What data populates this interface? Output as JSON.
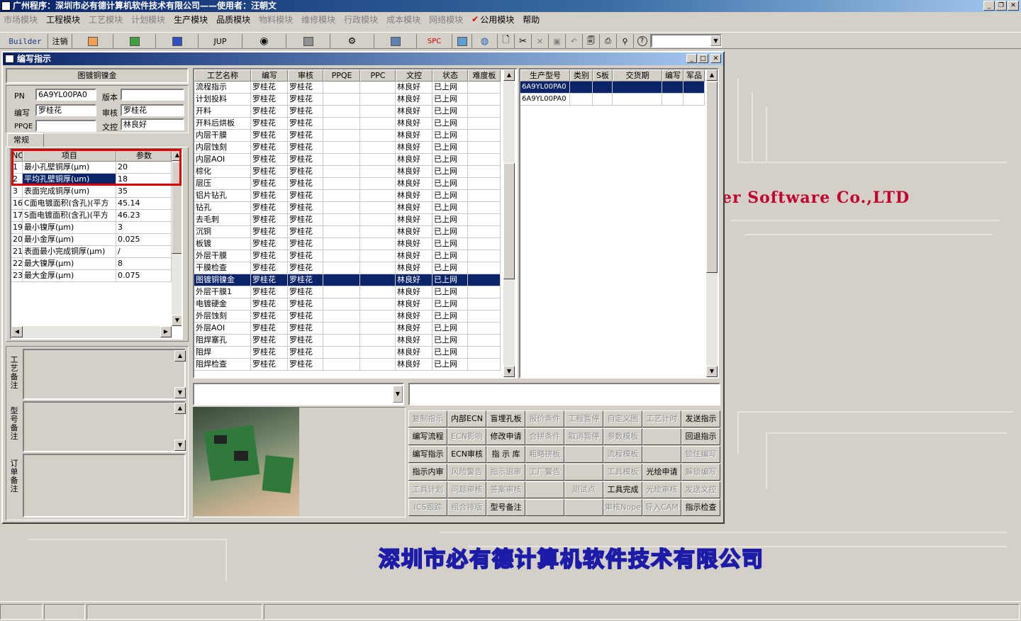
{
  "app": {
    "title": "广州程序：深圳市必有德计算机软件技术有限公司——使用者：汪朝文"
  },
  "menu": [
    "市场模块",
    "工程模块",
    "工艺模块",
    "计划模块",
    "生产模块",
    "品质模块",
    "物料模块",
    "维修模块",
    "行政模块",
    "成本模块",
    "网络模块",
    "公用模块",
    "帮助"
  ],
  "toolbar": {
    "builder": "Builder",
    "logout": "注销",
    "jup": "JUP",
    "spc": "SPC",
    "combo": ""
  },
  "window": {
    "title": "编写指示"
  },
  "info": {
    "product": "图镀铜镍金",
    "pn_label": "PN",
    "pn": "6A9YL00PA0",
    "version_label": "版本",
    "version": "",
    "editor_label": "编写",
    "editor": "罗桂花",
    "reviewer_label": "审核",
    "reviewer": "罗桂花",
    "ppqe_label": "PPQE",
    "ppqe": "",
    "doc_label": "文控",
    "doc": "林良好",
    "tab": "常规"
  },
  "params": {
    "headers": [
      "NO",
      "项目",
      "参数"
    ],
    "rows": [
      {
        "no": "1",
        "item": "最小孔壁铜厚(μm)",
        "value": "20"
      },
      {
        "no": "2",
        "item": "平均孔壁铜厚(um)",
        "value": "18"
      },
      {
        "no": "3",
        "item": "表面完成铜厚(um)",
        "value": "35"
      },
      {
        "no": "16",
        "item": "C面电镀面积(含孔)(平方",
        "value": "45.14"
      },
      {
        "no": "17",
        "item": "S面电镀面积(含孔)(平方",
        "value": "46.23"
      },
      {
        "no": "19",
        "item": "最小镍厚(μm)",
        "value": "3"
      },
      {
        "no": "20",
        "item": "最小金厚(μm)",
        "value": "0.025"
      },
      {
        "no": "21",
        "item": "表面最小完成铜厚(μm)",
        "value": "/"
      },
      {
        "no": "22",
        "item": "最大镍厚(μm)",
        "value": "8"
      },
      {
        "no": "23",
        "item": "最大金厚(μm)",
        "value": "0.075"
      }
    ]
  },
  "remarks": {
    "process": "工艺备注",
    "model": "型号备注",
    "order": "订单备注"
  },
  "process": {
    "headers": [
      "工艺名称",
      "编写",
      "审核",
      "PPQE",
      "PPC",
      "文控",
      "状态",
      "难度板"
    ],
    "rows": [
      [
        "流程指示",
        "罗桂花",
        "罗桂花",
        "",
        "",
        "林良好",
        "已上网",
        ""
      ],
      [
        "计划投料",
        "罗桂花",
        "罗桂花",
        "",
        "",
        "林良好",
        "已上网",
        ""
      ],
      [
        "开料",
        "罗桂花",
        "罗桂花",
        "",
        "",
        "林良好",
        "已上网",
        ""
      ],
      [
        "开料后烘板",
        "罗桂花",
        "罗桂花",
        "",
        "",
        "林良好",
        "已上网",
        ""
      ],
      [
        "内层干膜",
        "罗桂花",
        "罗桂花",
        "",
        "",
        "林良好",
        "已上网",
        ""
      ],
      [
        "内层蚀刻",
        "罗桂花",
        "罗桂花",
        "",
        "",
        "林良好",
        "已上网",
        ""
      ],
      [
        "内层AOI",
        "罗桂花",
        "罗桂花",
        "",
        "",
        "林良好",
        "已上网",
        ""
      ],
      [
        "棕化",
        "罗桂花",
        "罗桂花",
        "",
        "",
        "林良好",
        "已上网",
        ""
      ],
      [
        "层压",
        "罗桂花",
        "罗桂花",
        "",
        "",
        "林良好",
        "已上网",
        ""
      ],
      [
        "铝片钻孔",
        "罗桂花",
        "罗桂花",
        "",
        "",
        "林良好",
        "已上网",
        ""
      ],
      [
        "钻孔",
        "罗桂花",
        "罗桂花",
        "",
        "",
        "林良好",
        "已上网",
        ""
      ],
      [
        "去毛刺",
        "罗桂花",
        "罗桂花",
        "",
        "",
        "林良好",
        "已上网",
        ""
      ],
      [
        "沉铜",
        "罗桂花",
        "罗桂花",
        "",
        "",
        "林良好",
        "已上网",
        ""
      ],
      [
        "板镀",
        "罗桂花",
        "罗桂花",
        "",
        "",
        "林良好",
        "已上网",
        ""
      ],
      [
        "外层干膜",
        "罗桂花",
        "罗桂花",
        "",
        "",
        "林良好",
        "已上网",
        ""
      ],
      [
        "干膜检查",
        "罗桂花",
        "罗桂花",
        "",
        "",
        "林良好",
        "已上网",
        ""
      ],
      [
        "图镀铜镍金",
        "罗桂花",
        "罗桂花",
        "",
        "",
        "林良好",
        "已上网",
        ""
      ],
      [
        "外层干膜1",
        "罗桂花",
        "罗桂花",
        "",
        "",
        "林良好",
        "已上网",
        ""
      ],
      [
        "电镀硬金",
        "罗桂花",
        "罗桂花",
        "",
        "",
        "林良好",
        "已上网",
        ""
      ],
      [
        "外层蚀刻",
        "罗桂花",
        "罗桂花",
        "",
        "",
        "林良好",
        "已上网",
        ""
      ],
      [
        "外层AOI",
        "罗桂花",
        "罗桂花",
        "",
        "",
        "林良好",
        "已上网",
        ""
      ],
      [
        "阻焊塞孔",
        "罗桂花",
        "罗桂花",
        "",
        "",
        "林良好",
        "已上网",
        ""
      ],
      [
        "阻焊",
        "罗桂花",
        "罗桂花",
        "",
        "",
        "林良好",
        "已上网",
        ""
      ],
      [
        "阻焊检查",
        "罗桂花",
        "罗桂花",
        "",
        "",
        "林良好",
        "已上网",
        ""
      ]
    ]
  },
  "models": {
    "headers": [
      "生产型号",
      "类别",
      "S板",
      "交货期",
      "编写",
      "军品"
    ],
    "rows": [
      [
        "6A9YL00PA0",
        "",
        "",
        "",
        "",
        ""
      ],
      [
        "6A9YL00PA0",
        "",
        "",
        "",
        "",
        ""
      ]
    ]
  },
  "buttons": [
    [
      "复制指示",
      "内部ECN",
      "盲埋孔板",
      "报价条件",
      "工程暂停",
      "自定义图",
      "工艺计时",
      "发送指示"
    ],
    [
      "编写流程",
      "ECN影响",
      "修改申请",
      "合拼条件",
      "取消暂停",
      "参数模板",
      "",
      "回退指示"
    ],
    [
      "编写指示",
      "ECN审核",
      "指 示 库",
      "粗略拼板",
      "",
      "流程模板",
      "",
      "锁住编写"
    ],
    [
      "指示内审",
      "风险警告",
      "指示退审",
      "工厂警告",
      "",
      "工具模板",
      "光绘申请",
      "解锁编写"
    ],
    [
      "工具计划",
      "问题审核",
      "答案审核",
      "",
      "测试点",
      "工具完成",
      "光绘审核",
      "发送文控"
    ],
    [
      "ICS跟踪",
      "组合排版",
      "型号备注",
      "",
      "",
      "审核Nope",
      "导入CAM",
      "指示检查"
    ]
  ],
  "brand": {
    "en": "er Software Co.,LTD",
    "cn": "深圳市必有德计算机软件技术有限公司"
  },
  "colors": {
    "title_start": "#0a246a",
    "title_end": "#a6caf0",
    "selection": "#0a246a",
    "highlight_box": "#e00000",
    "brand_en": "#c00030",
    "brand_cn": "#1c1ca8"
  }
}
